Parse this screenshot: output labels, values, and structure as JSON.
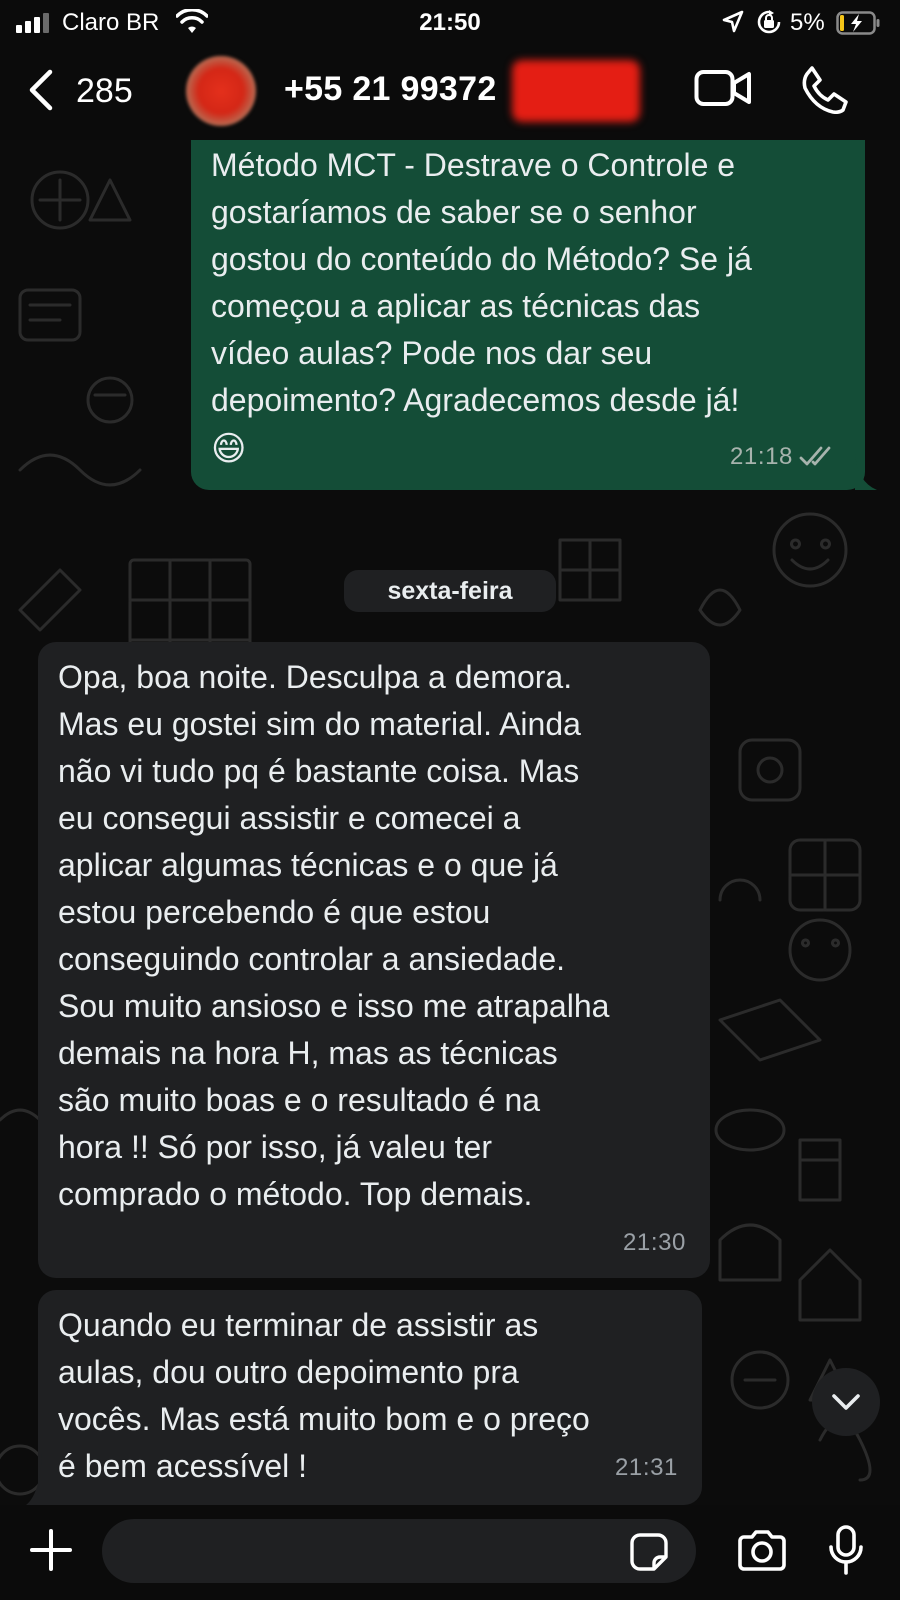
{
  "status_bar": {
    "carrier": "Claro BR",
    "time": "21:50",
    "battery_percent": "5%"
  },
  "header": {
    "back_count": "285",
    "contact_name": "+55 21 99372"
  },
  "messages": [
    {
      "direction": "outgoing",
      "text": "Método MCT - Destrave o Controle e\ngostaríamos de saber se o senhor\ngostou do conteúdo do Método? Se já\ncomeçou a aplicar as técnicas das\nvídeo aulas? Pode nos dar seu\ndepoimento? Agradecemos desde já!",
      "emoji": "😄",
      "time": "21:18",
      "status": "read"
    },
    {
      "direction": "incoming",
      "text": "Opa, boa noite. Desculpa a demora.\nMas eu gostei sim do material. Ainda\nnão vi tudo pq é bastante coisa. Mas\neu consegui assistir e comecei a\naplicar algumas técnicas e o que já\nestou percebendo é que estou\nconseguindo controlar a ansiedade.\nSou muito ansioso e isso me atrapalha\ndemais na hora H, mas as técnicas\nsão muito boas e o resultado é na\nhora !! Só por isso, já valeu ter\ncomprado o método. Top demais.",
      "time": "21:30"
    },
    {
      "direction": "incoming",
      "text": "Quando eu terminar de assistir as\naulas, dou outro depoimento pra\nvocês. Mas está muito bom e o preço\né bem acessível !",
      "time": "21:31"
    }
  ],
  "day_separator": "sexta-feira",
  "composer": {
    "placeholder": ""
  },
  "colors": {
    "outgoing_bubble": "#144d37",
    "incoming_bubble": "#1f2022",
    "background": "#0b0b0b",
    "read_ticks": "#a7b3ad"
  },
  "icons": [
    "signal-icon",
    "wifi-icon",
    "location-arrow-icon",
    "rotation-lock-icon",
    "battery-charging-icon",
    "back-chevron-icon",
    "video-call-icon",
    "phone-icon",
    "double-check-icon",
    "chevron-down-icon",
    "plus-icon",
    "sticker-icon",
    "camera-icon",
    "microphone-icon"
  ]
}
